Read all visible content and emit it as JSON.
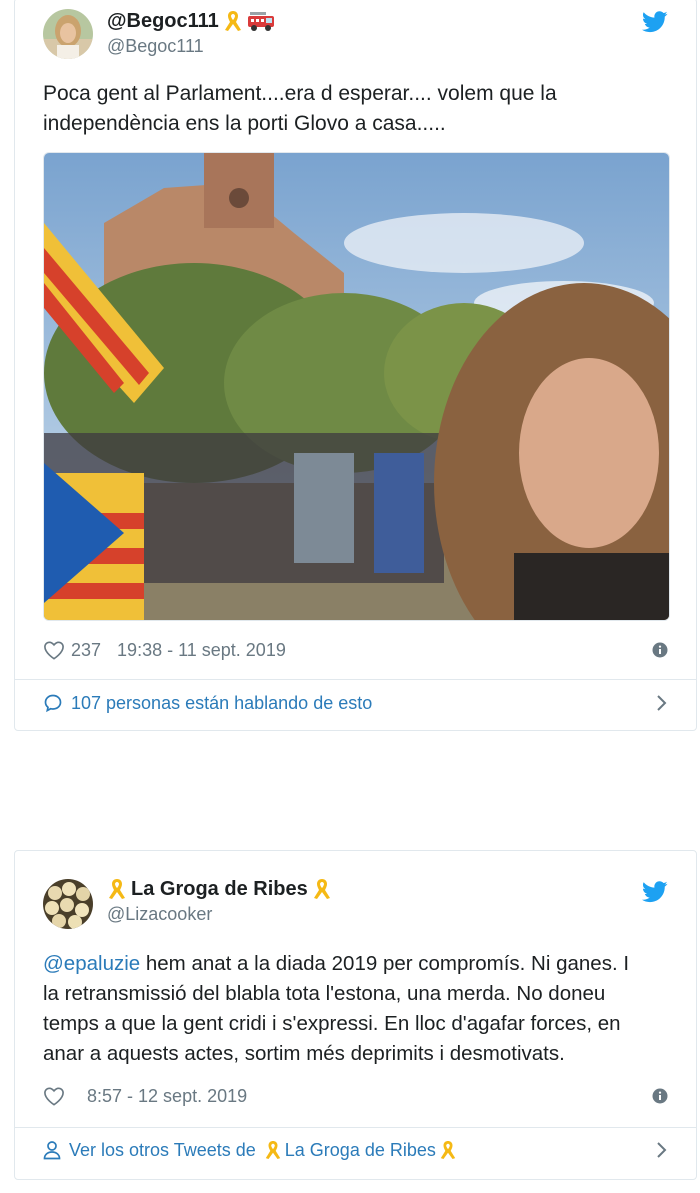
{
  "tweets": [
    {
      "display_name": "@Begoc111",
      "handle": "@Begoc111",
      "name_badges": [
        "yellow-ribbon-icon",
        "fire-engine-icon"
      ],
      "text": "Poca gent al Parlament....era d esperar.... volem que la independència ens la porti Glovo  a casa.....",
      "likes": "237",
      "timestamp": "19:38 - 11 sept. 2019",
      "footer_link": "107 personas están hablando de esto",
      "photo_alt": "Photo: selfie in front of Parlament with crowd and flags"
    },
    {
      "display_name": "La Groga de Ribes",
      "handle": "@Lizacooker",
      "name_badges": [
        "yellow-ribbon-icon",
        "yellow-ribbon-icon"
      ],
      "mention": "@epaluzie",
      "text_lines": [
        " hem anat a la diada 2019 per compromís. Ni ganes. I",
        "la retransmissió del blabla tota l'estona, una merda. No doneu",
        "temps a que la gent cridi i s'expressi. En lloc d'agafar forces, en",
        "anar a aquests actes, sortim més deprimits i desmotivats."
      ],
      "likes": "",
      "timestamp": "8:57 - 12 sept. 2019",
      "footer_prefix": "Ver los otros Tweets de ",
      "footer_name": "La Groga de Ribes"
    }
  ],
  "colors": {
    "link": "#2b7bb9",
    "muted": "#697882",
    "twitter_blue": "#1da1f2",
    "ribbon": "#f5b915",
    "border": "#e1e8ed"
  }
}
